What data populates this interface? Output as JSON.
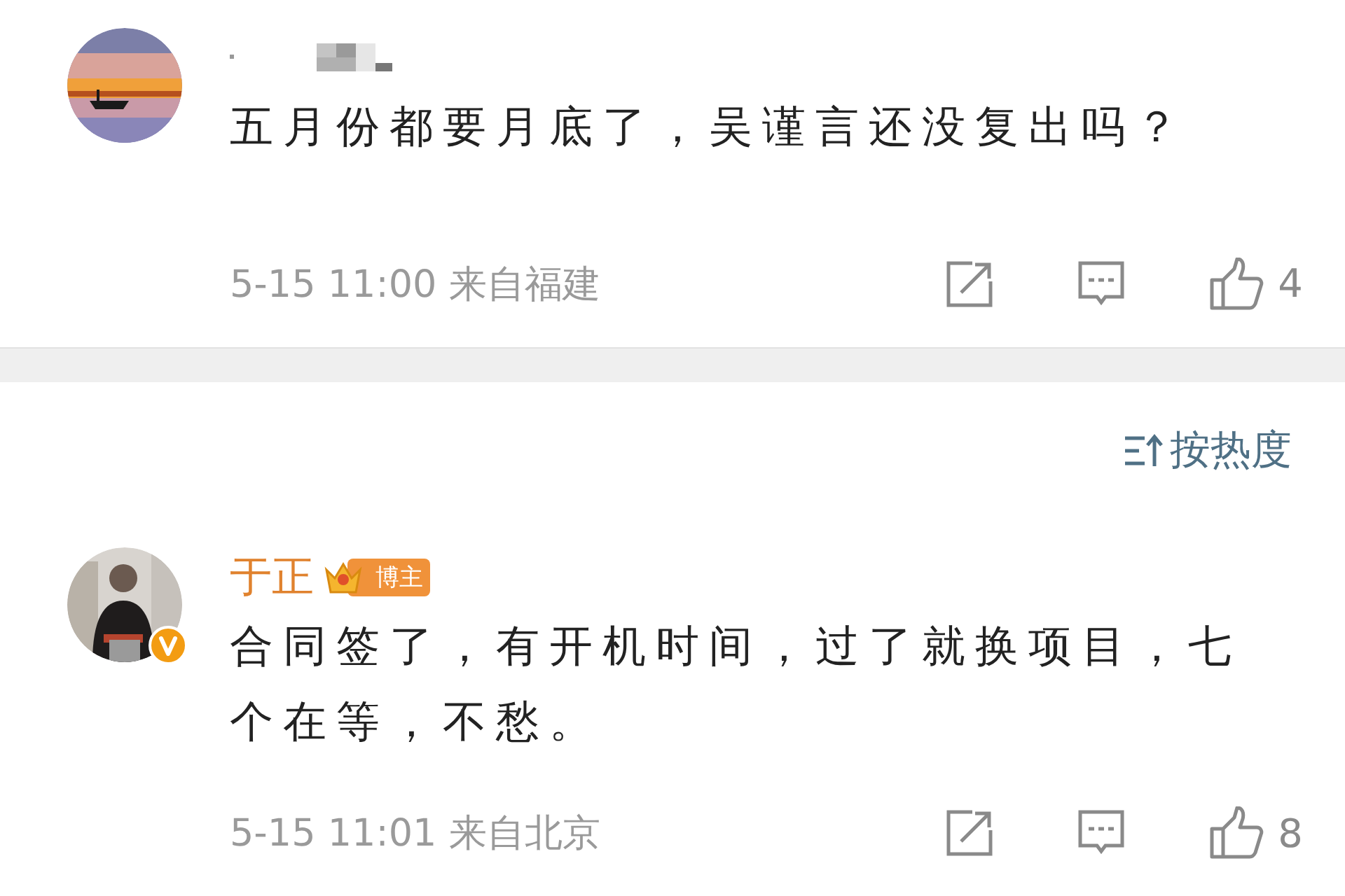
{
  "comments": [
    {
      "author": {
        "kind": "redacted"
      },
      "avatar": {
        "kind": "picture",
        "verified": false
      },
      "text": "五月份都要月底了，吴谨言还没复出吗？",
      "time": "5-15 11:00",
      "location": "来自福建",
      "likes": "4"
    },
    {
      "author": {
        "kind": "named",
        "name": "于正",
        "badge": "博主"
      },
      "avatar": {
        "kind": "picture",
        "verified": true
      },
      "text": "合同签了，有开机时间，过了就换项目，七个在等，不愁。",
      "time": "5-15 11:01",
      "location": "来自北京",
      "likes": "8"
    }
  ],
  "sort": {
    "label": "按热度"
  }
}
